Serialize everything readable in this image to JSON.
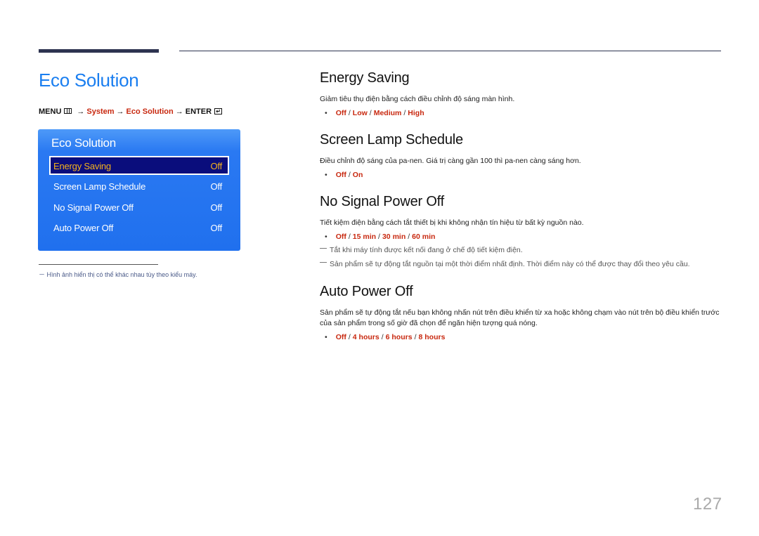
{
  "header": {
    "title": "Eco Solution",
    "menu_path": {
      "menu": "MENU",
      "arrow": "→",
      "system": "System",
      "eco": "Eco Solution",
      "enter": "ENTER"
    }
  },
  "osd": {
    "title": "Eco Solution",
    "items": [
      {
        "label": "Energy Saving",
        "value": "Off",
        "selected": true
      },
      {
        "label": "Screen Lamp Schedule",
        "value": "Off"
      },
      {
        "label": "No Signal Power Off",
        "value": "Off"
      },
      {
        "label": "Auto Power Off",
        "value": "Off"
      }
    ]
  },
  "footnote": "－ Hình ảnh hiển thị có thể khác nhau tùy theo kiểu máy.",
  "sections": [
    {
      "title": "Energy Saving",
      "desc": "Giảm tiêu thụ điện bằng cách điều chỉnh độ sáng màn hình.",
      "options": [
        "Off",
        "Low",
        "Medium",
        "High"
      ]
    },
    {
      "title": "Screen Lamp Schedule",
      "desc": "Điều chỉnh độ sáng của pa-nen. Giá trị càng gần 100 thì pa-nen càng sáng hơn.",
      "options": [
        "Off",
        "On"
      ]
    },
    {
      "title": "No Signal Power Off",
      "desc": "Tiết kiệm điện bằng cách tắt thiết bị khi không nhận tín hiệu từ bất kỳ nguồn nào.",
      "options": [
        "Off",
        "15 min",
        "30 min",
        "60 min"
      ],
      "notes": [
        "Tắt khi máy tính được kết nối đang ở chế độ tiết kiệm điện.",
        "Sản phẩm sẽ tự động tắt nguồn tại một thời điểm nhất định. Thời điểm này có thể được thay đổi theo yêu cầu."
      ]
    },
    {
      "title": "Auto Power Off",
      "desc": "Sản phẩm sẽ tự động tắt nếu bạn không nhấn nút trên điều khiển từ xa hoặc không chạm vào nút trên bộ điều khiển trước của sản phẩm trong số giờ đã chọn để ngăn hiện tượng quá nóng.",
      "options": [
        "Off",
        "4 hours",
        "6 hours",
        "8 hours"
      ]
    }
  ],
  "page_number": "127",
  "option_separator": "/",
  "bullet": "•"
}
